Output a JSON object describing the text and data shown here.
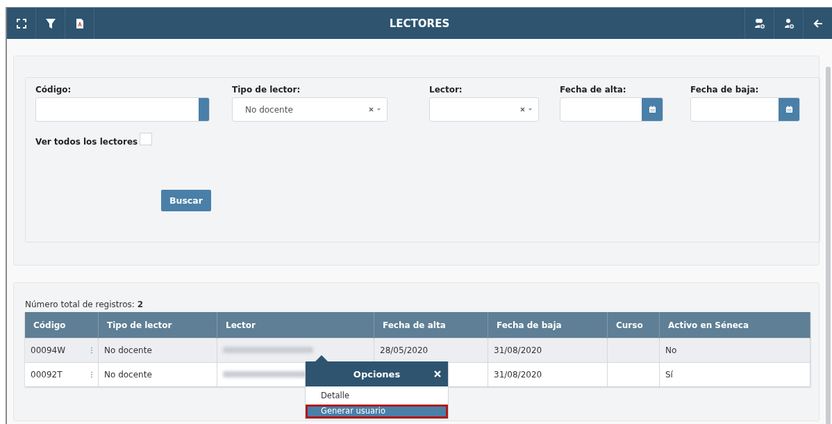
{
  "toolbar": {
    "title": "LECTORES",
    "left_buttons": [
      {
        "kind": "expand"
      },
      {
        "kind": "filter"
      },
      {
        "kind": "pdf"
      }
    ],
    "right_buttons": [
      {
        "kind": "add-group"
      },
      {
        "kind": "add-user"
      },
      {
        "kind": "back"
      }
    ]
  },
  "filters": {
    "fields": [
      {
        "label": "Código:",
        "kind": "text"
      },
      {
        "label": "Tipo de lector:",
        "kind": "select",
        "value": "No docente"
      },
      {
        "label": "Lector:",
        "kind": "select"
      },
      {
        "label": "Fecha de alta:",
        "kind": "date"
      },
      {
        "label": "Fecha de baja:",
        "kind": "date"
      }
    ],
    "checkbox": {
      "label": "Ver todos los lectores",
      "checked": false
    },
    "button": "Buscar"
  },
  "results": {
    "total": "Número total de registros: **2**",
    "columns": [
      {
        "label": "Código",
        "kind": "menu"
      },
      {
        "label": "Tipo de lector",
        "kind": "text"
      },
      {
        "label": "Lector",
        "kind": "blurred"
      },
      {
        "label": "Fecha de alta",
        "kind": "text"
      },
      {
        "label": "Fecha de baja",
        "kind": "text"
      },
      {
        "label": "Curso",
        "kind": "text"
      },
      {
        "label": "Activo en Séneca",
        "kind": "text"
      }
    ],
    "rows": [
      {
        "selected": true,
        "cells": [
          "00094W",
          "No docente",
          null,
          "28/05/2020",
          "31/08/2020",
          null,
          "No"
        ]
      },
      {
        "selected": false,
        "cells": [
          "00092T",
          "No docente",
          null,
          null,
          "31/08/2020",
          null,
          "Sí"
        ]
      }
    ]
  },
  "popup": {
    "title": "Opciones",
    "items": [
      {
        "label": "Detalle",
        "highlighted": false
      },
      {
        "label": "Generar usuario",
        "highlighted": true
      }
    ]
  }
}
